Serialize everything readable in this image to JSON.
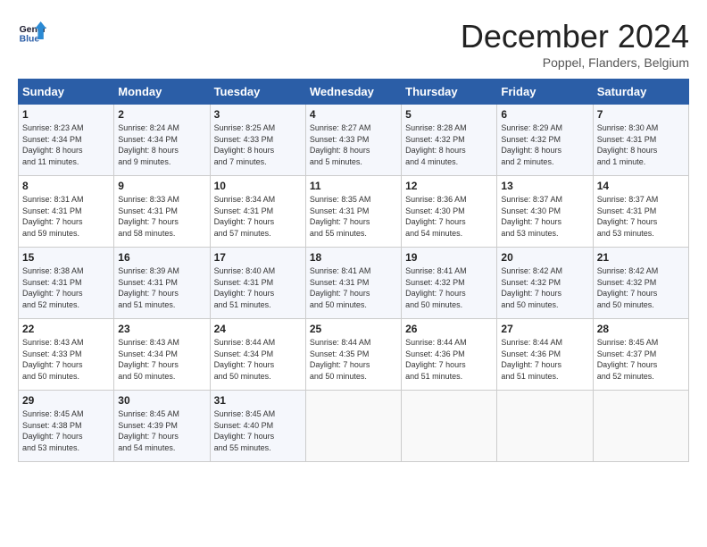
{
  "header": {
    "logo_line1": "General",
    "logo_line2": "Blue",
    "month_title": "December 2024",
    "location": "Poppel, Flanders, Belgium"
  },
  "weekdays": [
    "Sunday",
    "Monday",
    "Tuesday",
    "Wednesday",
    "Thursday",
    "Friday",
    "Saturday"
  ],
  "weeks": [
    [
      {
        "day": "1",
        "info": "Sunrise: 8:23 AM\nSunset: 4:34 PM\nDaylight: 8 hours\nand 11 minutes."
      },
      {
        "day": "2",
        "info": "Sunrise: 8:24 AM\nSunset: 4:34 PM\nDaylight: 8 hours\nand 9 minutes."
      },
      {
        "day": "3",
        "info": "Sunrise: 8:25 AM\nSunset: 4:33 PM\nDaylight: 8 hours\nand 7 minutes."
      },
      {
        "day": "4",
        "info": "Sunrise: 8:27 AM\nSunset: 4:33 PM\nDaylight: 8 hours\nand 5 minutes."
      },
      {
        "day": "5",
        "info": "Sunrise: 8:28 AM\nSunset: 4:32 PM\nDaylight: 8 hours\nand 4 minutes."
      },
      {
        "day": "6",
        "info": "Sunrise: 8:29 AM\nSunset: 4:32 PM\nDaylight: 8 hours\nand 2 minutes."
      },
      {
        "day": "7",
        "info": "Sunrise: 8:30 AM\nSunset: 4:31 PM\nDaylight: 8 hours\nand 1 minute."
      }
    ],
    [
      {
        "day": "8",
        "info": "Sunrise: 8:31 AM\nSunset: 4:31 PM\nDaylight: 7 hours\nand 59 minutes."
      },
      {
        "day": "9",
        "info": "Sunrise: 8:33 AM\nSunset: 4:31 PM\nDaylight: 7 hours\nand 58 minutes."
      },
      {
        "day": "10",
        "info": "Sunrise: 8:34 AM\nSunset: 4:31 PM\nDaylight: 7 hours\nand 57 minutes."
      },
      {
        "day": "11",
        "info": "Sunrise: 8:35 AM\nSunset: 4:31 PM\nDaylight: 7 hours\nand 55 minutes."
      },
      {
        "day": "12",
        "info": "Sunrise: 8:36 AM\nSunset: 4:30 PM\nDaylight: 7 hours\nand 54 minutes."
      },
      {
        "day": "13",
        "info": "Sunrise: 8:37 AM\nSunset: 4:30 PM\nDaylight: 7 hours\nand 53 minutes."
      },
      {
        "day": "14",
        "info": "Sunrise: 8:37 AM\nSunset: 4:31 PM\nDaylight: 7 hours\nand 53 minutes."
      }
    ],
    [
      {
        "day": "15",
        "info": "Sunrise: 8:38 AM\nSunset: 4:31 PM\nDaylight: 7 hours\nand 52 minutes."
      },
      {
        "day": "16",
        "info": "Sunrise: 8:39 AM\nSunset: 4:31 PM\nDaylight: 7 hours\nand 51 minutes."
      },
      {
        "day": "17",
        "info": "Sunrise: 8:40 AM\nSunset: 4:31 PM\nDaylight: 7 hours\nand 51 minutes."
      },
      {
        "day": "18",
        "info": "Sunrise: 8:41 AM\nSunset: 4:31 PM\nDaylight: 7 hours\nand 50 minutes."
      },
      {
        "day": "19",
        "info": "Sunrise: 8:41 AM\nSunset: 4:32 PM\nDaylight: 7 hours\nand 50 minutes."
      },
      {
        "day": "20",
        "info": "Sunrise: 8:42 AM\nSunset: 4:32 PM\nDaylight: 7 hours\nand 50 minutes."
      },
      {
        "day": "21",
        "info": "Sunrise: 8:42 AM\nSunset: 4:32 PM\nDaylight: 7 hours\nand 50 minutes."
      }
    ],
    [
      {
        "day": "22",
        "info": "Sunrise: 8:43 AM\nSunset: 4:33 PM\nDaylight: 7 hours\nand 50 minutes."
      },
      {
        "day": "23",
        "info": "Sunrise: 8:43 AM\nSunset: 4:34 PM\nDaylight: 7 hours\nand 50 minutes."
      },
      {
        "day": "24",
        "info": "Sunrise: 8:44 AM\nSunset: 4:34 PM\nDaylight: 7 hours\nand 50 minutes."
      },
      {
        "day": "25",
        "info": "Sunrise: 8:44 AM\nSunset: 4:35 PM\nDaylight: 7 hours\nand 50 minutes."
      },
      {
        "day": "26",
        "info": "Sunrise: 8:44 AM\nSunset: 4:36 PM\nDaylight: 7 hours\nand 51 minutes."
      },
      {
        "day": "27",
        "info": "Sunrise: 8:44 AM\nSunset: 4:36 PM\nDaylight: 7 hours\nand 51 minutes."
      },
      {
        "day": "28",
        "info": "Sunrise: 8:45 AM\nSunset: 4:37 PM\nDaylight: 7 hours\nand 52 minutes."
      }
    ],
    [
      {
        "day": "29",
        "info": "Sunrise: 8:45 AM\nSunset: 4:38 PM\nDaylight: 7 hours\nand 53 minutes."
      },
      {
        "day": "30",
        "info": "Sunrise: 8:45 AM\nSunset: 4:39 PM\nDaylight: 7 hours\nand 54 minutes."
      },
      {
        "day": "31",
        "info": "Sunrise: 8:45 AM\nSunset: 4:40 PM\nDaylight: 7 hours\nand 55 minutes."
      },
      {
        "day": "",
        "info": ""
      },
      {
        "day": "",
        "info": ""
      },
      {
        "day": "",
        "info": ""
      },
      {
        "day": "",
        "info": ""
      }
    ]
  ]
}
